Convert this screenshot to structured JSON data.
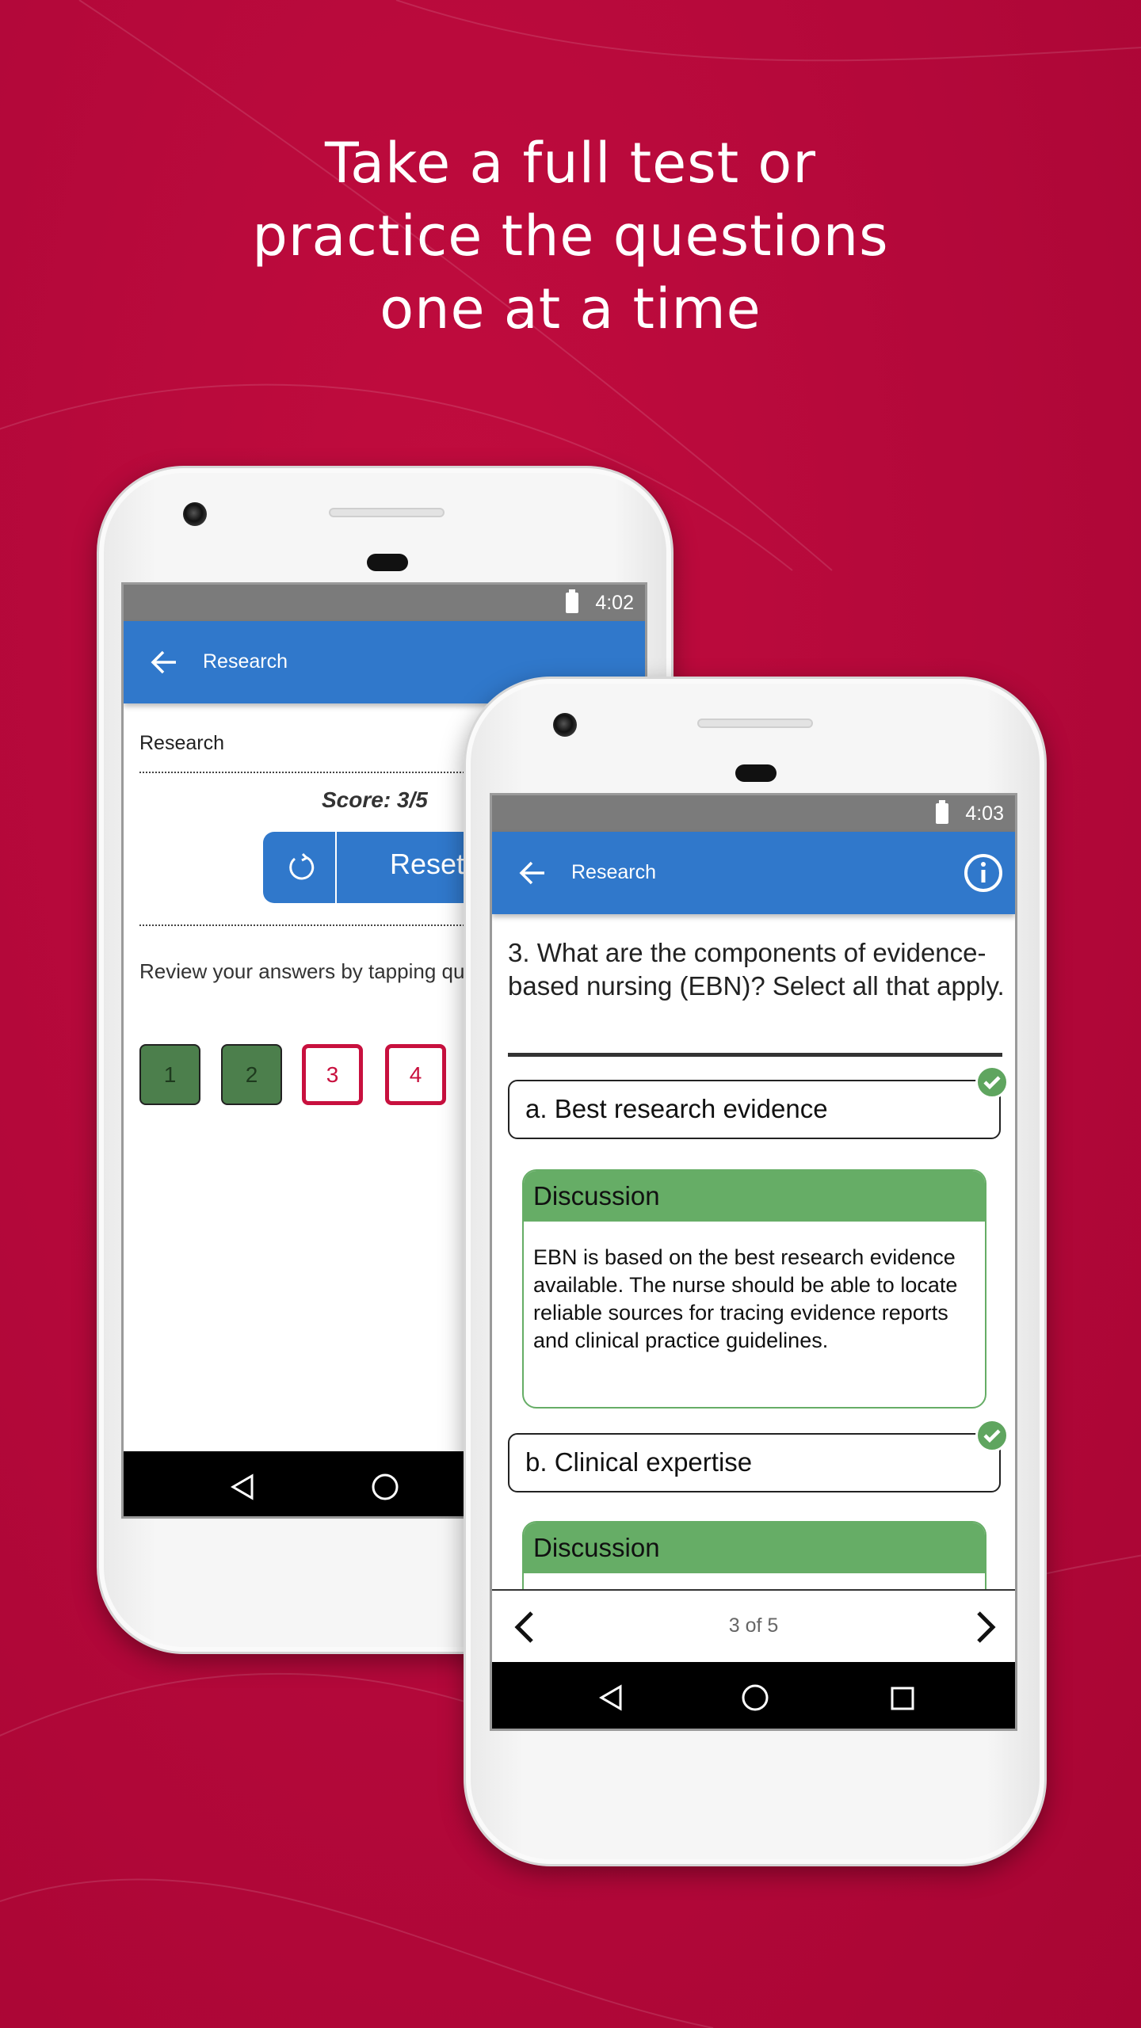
{
  "headline": [
    "Take a full test or",
    "practice the questions",
    "one at a time"
  ],
  "colors": {
    "background": "#b70a38",
    "app_bar": "#3078cb",
    "correct": "#66ad66",
    "incorrect": "#c8103e"
  },
  "back_phone": {
    "status_time": "4:02",
    "app_bar_title": "Research",
    "section_title": "Research",
    "score": "Score: 3/5",
    "reset_label": "Reset",
    "review_text": "Review your answers by tapping questions below.",
    "questions": [
      {
        "label": "1",
        "state": "correct"
      },
      {
        "label": "2",
        "state": "correct"
      },
      {
        "label": "3",
        "state": "incorrect"
      },
      {
        "label": "4",
        "state": "incorrect"
      }
    ]
  },
  "front_phone": {
    "status_time": "4:03",
    "app_bar_title": "Research",
    "question": "3. What are the components of evidence-based nursing (EBN)? Select all that apply.",
    "options": [
      {
        "label": "a. Best research evidence",
        "correct": true,
        "discussion_title": "Discussion",
        "discussion": "EBN is based on the best research evidence available. The nurse should be able to locate reliable sources for tracing evidence reports and clinical practice guidelines."
      },
      {
        "label": "b. Clinical expertise",
        "correct": true,
        "discussion_title": "Discussion"
      }
    ],
    "pager": "3 of 5"
  }
}
